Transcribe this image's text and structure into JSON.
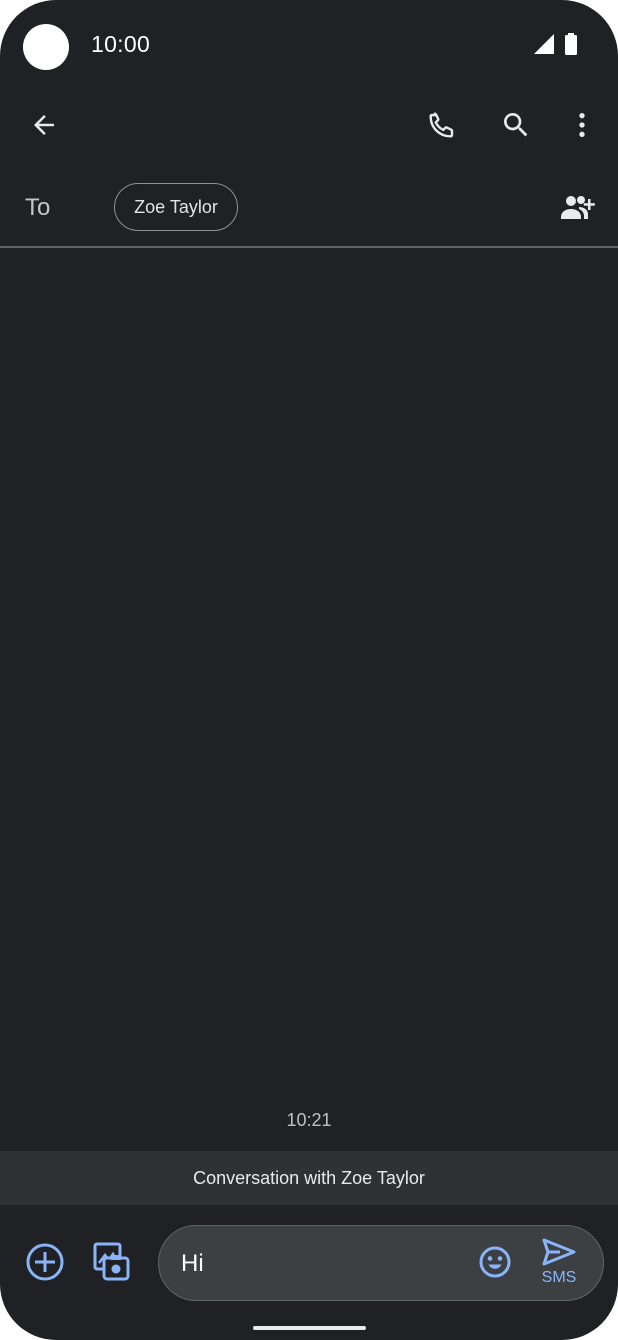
{
  "status_bar": {
    "time": "10:00",
    "icons": [
      "signal-icon",
      "battery-icon"
    ]
  },
  "app_bar": {
    "back_icon": "arrow-left-icon",
    "actions": [
      "phone-icon",
      "search-icon",
      "more-vert-icon"
    ]
  },
  "recipient": {
    "to_label": "To",
    "chips": [
      "Zoe Taylor"
    ],
    "add_icon": "add-person-icon"
  },
  "conversation": {
    "timestamp": "10:21",
    "banner": "Conversation with Zoe Taylor"
  },
  "compose": {
    "attach_icon": "plus-circle-icon",
    "gallery_icon": "gallery-icon",
    "message_value": "Hi",
    "emoji_icon": "emoji-icon",
    "send_icon": "send-icon",
    "send_label": "SMS"
  },
  "colors": {
    "background": "#202124",
    "accent": "#8ab4f8",
    "text": "#e8eaed"
  }
}
